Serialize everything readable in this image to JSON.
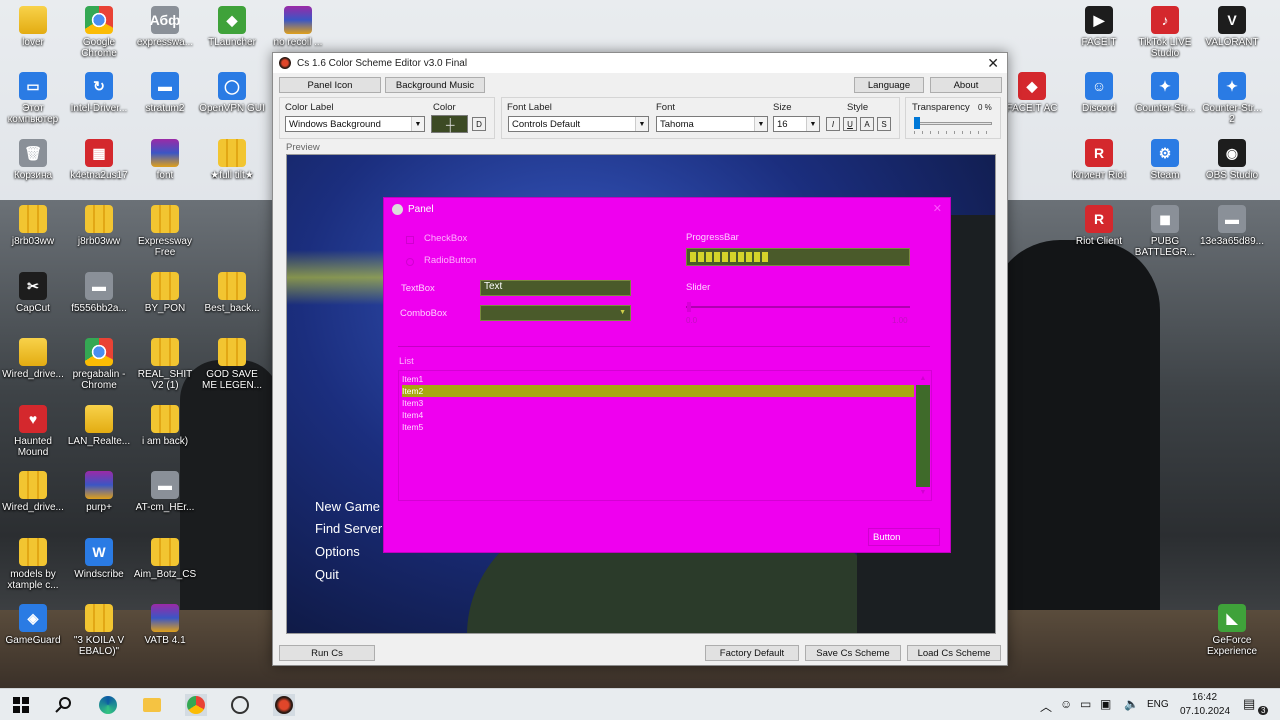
{
  "desktop": {
    "icons": [
      {
        "label": "lover",
        "glyph": "",
        "icon": "folder-icon"
      },
      {
        "label": "Google Chrome",
        "glyph": "",
        "icon": "chrome-icon"
      },
      {
        "label": "expresswa...",
        "glyph": "Абф",
        "icon": "document-icon"
      },
      {
        "label": "TLauncher",
        "glyph": "◆",
        "icon": "tlauncher-icon"
      },
      {
        "label": "no recoil ...",
        "glyph": "",
        "icon": "winrar-icon"
      },
      {
        "label": "Этот компьютер",
        "glyph": "▭",
        "icon": "computer-icon"
      },
      {
        "label": "Intel-Driver...",
        "glyph": "↻",
        "icon": "intel-driver-icon"
      },
      {
        "label": "stratum2",
        "glyph": "▬",
        "icon": "stratum-icon"
      },
      {
        "label": "OpenVPN GUI",
        "glyph": "◯",
        "icon": "openvpn-icon"
      },
      {
        "label": "Корзина",
        "glyph": "🗑",
        "icon": "recycle-bin-icon"
      },
      {
        "label": "k4etna2us17",
        "glyph": "▦",
        "icon": "app-icon"
      },
      {
        "label": "font",
        "glyph": "",
        "icon": "winrar-icon"
      },
      {
        "label": "★full tilt★",
        "glyph": "",
        "icon": "zip-icon"
      },
      {
        "label": "j8rb03ww",
        "glyph": "",
        "icon": "zip-icon"
      },
      {
        "label": "j8rb03ww",
        "glyph": "",
        "icon": "zip-icon"
      },
      {
        "label": "Expressway Free",
        "glyph": "",
        "icon": "zip-icon"
      },
      {
        "label": "CapCut",
        "glyph": "✂",
        "icon": "capcut-icon"
      },
      {
        "label": "f5556bb2a...",
        "glyph": "▬",
        "icon": "file-icon"
      },
      {
        "label": "BY_PON",
        "glyph": "",
        "icon": "zip-icon"
      },
      {
        "label": "Best_back...",
        "glyph": "",
        "icon": "zip-icon"
      },
      {
        "label": "Wired_drive...",
        "glyph": "",
        "icon": "folder-icon"
      },
      {
        "label": "pregabalin - Chrome",
        "glyph": "",
        "icon": "chrome-icon"
      },
      {
        "label": "REAL_SHIT V2 (1)",
        "glyph": "",
        "icon": "zip-icon"
      },
      {
        "label": "GOD SAVE ME LEGEN...",
        "glyph": "",
        "icon": "zip-icon"
      },
      {
        "label": "Haunted Mound",
        "glyph": "♥",
        "icon": "app-icon"
      },
      {
        "label": "LAN_Realte...",
        "glyph": "",
        "icon": "folder-icon"
      },
      {
        "label": "i am back)",
        "glyph": "",
        "icon": "zip-icon"
      },
      {
        "label": "Wired_drive...",
        "glyph": "",
        "icon": "zip-icon"
      },
      {
        "label": "purp+",
        "glyph": "",
        "icon": "winrar-icon"
      },
      {
        "label": "AT-cm_HEr...",
        "glyph": "▬",
        "icon": "file-icon"
      },
      {
        "label": "models by xtample c...",
        "glyph": "",
        "icon": "zip-icon"
      },
      {
        "label": "Windscribe",
        "glyph": "W",
        "icon": "windscribe-icon"
      },
      {
        "label": "Aim_Botz_CS",
        "glyph": "",
        "icon": "zip-icon"
      },
      {
        "label": "GameGuard",
        "glyph": "◈",
        "icon": "gameguard-icon"
      },
      {
        "label": "\"3 KOILA V EBALO)\"",
        "glyph": "",
        "icon": "zip-icon"
      },
      {
        "label": "VATB 4.1",
        "glyph": "",
        "icon": "winrar-icon"
      },
      {
        "label": "FACEIT",
        "glyph": "▶",
        "icon": "faceit-icon"
      },
      {
        "label": "TikTok LIVE Studio",
        "glyph": "♪",
        "icon": "tiktok-icon"
      },
      {
        "label": "VALORANT",
        "glyph": "V",
        "icon": "valorant-icon"
      },
      {
        "label": "FACEIT AC",
        "glyph": "◆",
        "icon": "faceit-ac-icon"
      },
      {
        "label": "Discord",
        "glyph": "☺",
        "icon": "discord-icon"
      },
      {
        "label": "Counter-Str...",
        "glyph": "✦",
        "icon": "counter-strike-icon"
      },
      {
        "label": "Counter-Str... 2",
        "glyph": "✦",
        "icon": "counter-strike-2-icon"
      },
      {
        "label": "Клиент Riot",
        "glyph": "R",
        "icon": "riot-client-icon"
      },
      {
        "label": "Steam",
        "glyph": "⚙",
        "icon": "steam-icon"
      },
      {
        "label": "OBS Studio",
        "glyph": "◉",
        "icon": "obs-icon"
      },
      {
        "label": "Riot Client",
        "glyph": "R",
        "icon": "riot-client-icon"
      },
      {
        "label": "PUBG BATTLEGR...",
        "glyph": "◼",
        "icon": "pubg-icon"
      },
      {
        "label": "13e3a65d89...",
        "glyph": "▬",
        "icon": "file-icon"
      },
      {
        "label": "GeForce Experience",
        "glyph": "◣",
        "icon": "geforce-icon"
      }
    ]
  },
  "window": {
    "title": "Cs 1.6 Color Scheme Editor v3.0 Final",
    "close": "✕",
    "top_buttons": {
      "panel_icon": "Panel Icon",
      "background_music": "Background Music",
      "language": "Language",
      "about": "About"
    },
    "color_group": {
      "color_label_caption": "Color Label",
      "color_caption": "Color",
      "color_label_value": "Windows Background",
      "d_button": "D",
      "swatch_color": "#3c4a24"
    },
    "font_group": {
      "font_label_caption": "Font Label",
      "font_caption": "Font",
      "size_caption": "Size",
      "style_caption": "Style",
      "font_label_value": "Controls Default",
      "font_value": "Tahoma",
      "size_value": "16",
      "style_buttons": [
        "I",
        "U",
        "A",
        "S"
      ]
    },
    "transparency": {
      "caption": "Transparency",
      "value": "0 %",
      "level": 0
    },
    "preview_caption": "Preview",
    "game_menu": [
      "New Game",
      "Find Server",
      "Options",
      "Quit"
    ],
    "bottom_buttons": {
      "run": "Run Cs",
      "factory": "Factory Default",
      "save": "Save Cs Scheme",
      "load": "Load Cs Scheme"
    }
  },
  "panel": {
    "title": "Panel",
    "close": "✕",
    "checkbox_label": "CheckBox",
    "radio_label": "RadioButton",
    "textbox_label": "TextBox",
    "textbox_value": "Text",
    "combobox_label": "ComboBox",
    "progress_label": "ProgressBar",
    "progress_value": 0.38,
    "slider_label": "Slider",
    "slider_min": "0.0",
    "slider_max": "1.00",
    "list_label": "List",
    "list_items": [
      "Item1",
      "Item2",
      "Item3",
      "Item4",
      "Item5"
    ],
    "selected_item": "Item2",
    "button_label": "Button",
    "colors": {
      "background": "#ef00ef",
      "fg_box": "#4a5a2a",
      "accent": "#d4d42a"
    }
  },
  "taskbar": {
    "lang": "ENG",
    "time": "16:42",
    "date": "07.10.2024",
    "notif": "3"
  }
}
